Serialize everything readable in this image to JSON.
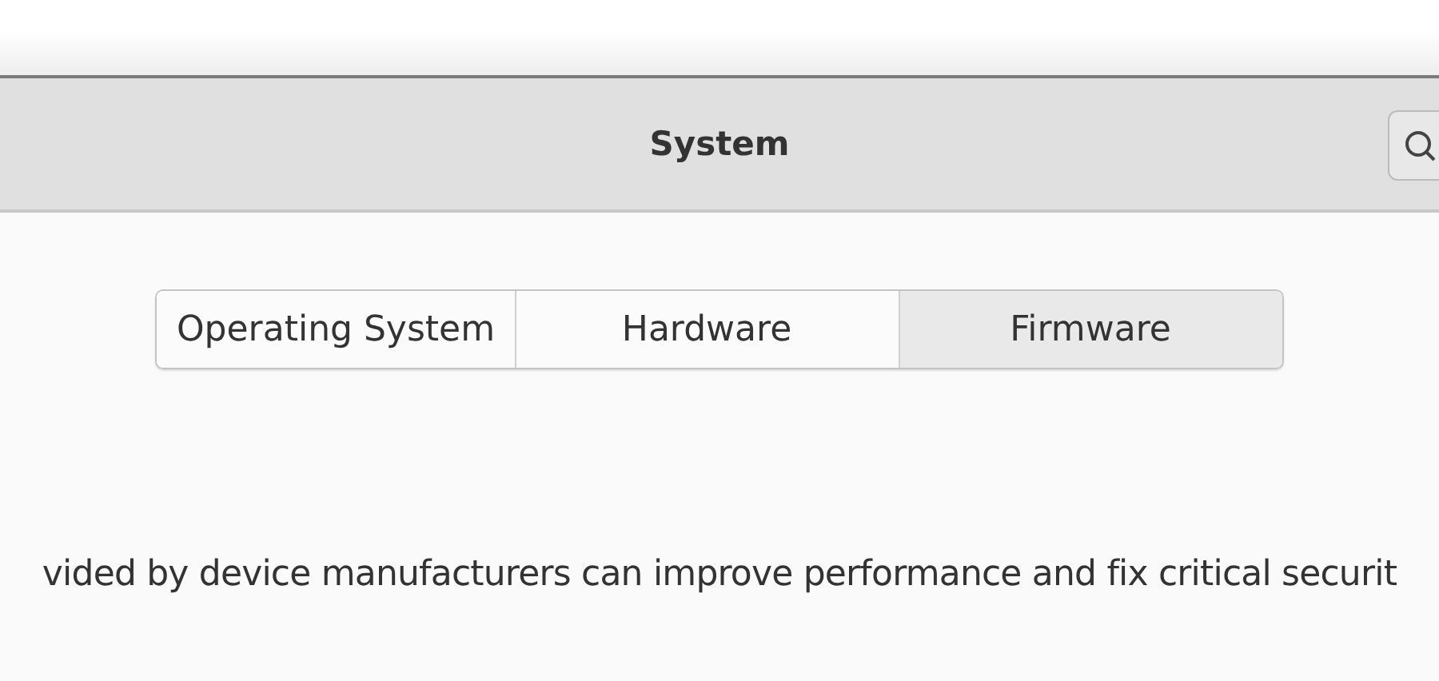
{
  "window": {
    "title": "System"
  },
  "header": {
    "search_button": {
      "kind": "search"
    }
  },
  "tabs": [
    {
      "label": "Operating System",
      "selected": false
    },
    {
      "label": "Hardware",
      "selected": false
    },
    {
      "label": "Firmware",
      "selected": true
    }
  ],
  "description": "vided by device manufacturers can improve performance and fix critical securit"
}
